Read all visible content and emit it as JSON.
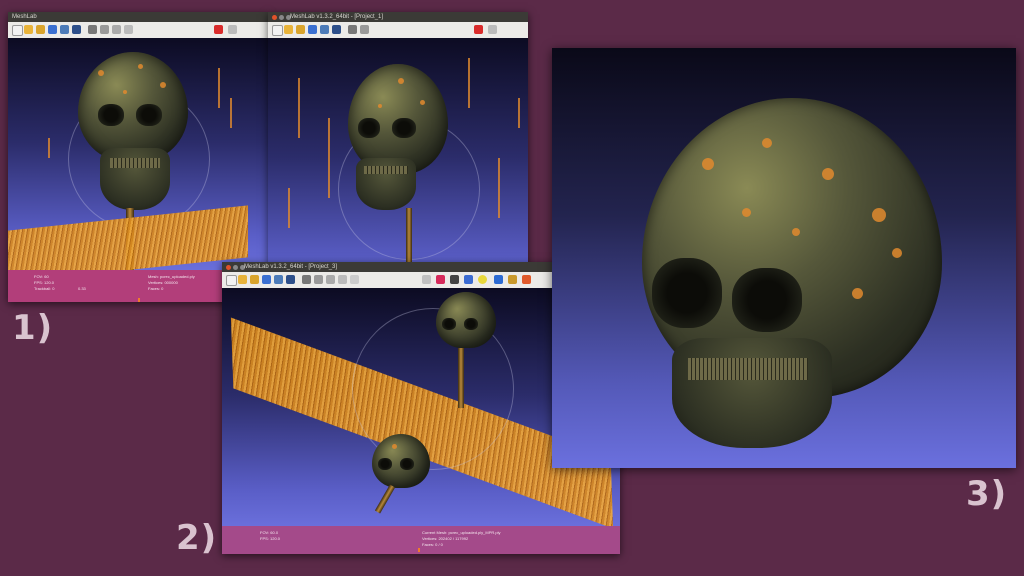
{
  "labels": {
    "one": "1)",
    "two": "2)",
    "three": "3)"
  },
  "window1": {
    "title": "MeshLab",
    "status_left": [
      "FOV: 60",
      "FPS: 120.0",
      "Trackball: 0",
      "0.33"
    ],
    "status_right": [
      "Mesh: pcrec_uploaded.ply",
      "Vertices: 000000",
      "Faces: 0"
    ]
  },
  "window2": {
    "title": "MeshLab v1.3.2_64bit - [Project_1]"
  },
  "window3": {
    "title": "MeshLab v1.3.2_64bit - [Project_3]",
    "status_left": [
      "FOV: 60.0",
      "FPS: 120.0"
    ],
    "status_right": [
      "Current Mesh: pcrec_uploaded.ply_MPR.ply",
      "Vertices: 202402 / 117992",
      "Faces: 0 / 0"
    ]
  },
  "colors": {
    "accent_status": "#b23e7a",
    "background": "#5b2a48",
    "pointcloud": "#e08a2e"
  },
  "icons": [
    "new-file-icon",
    "open-folder-icon",
    "save-icon",
    "reload-icon",
    "layers-icon",
    "render-icon",
    "delete-icon",
    "search-icon"
  ]
}
